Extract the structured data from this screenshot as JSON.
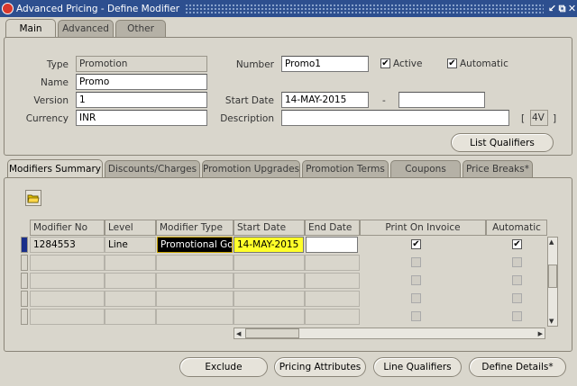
{
  "window": {
    "title": "Advanced Pricing - Define Modifier",
    "buttons": [
      "↙",
      "⧉",
      "✕"
    ]
  },
  "top_tabs": [
    {
      "label": "Main",
      "active": true
    },
    {
      "label": "Advanced",
      "active": false
    },
    {
      "label": "Other",
      "active": false
    }
  ],
  "header": {
    "type_label": "Type",
    "type_value": "Promotion",
    "name_label": "Name",
    "name_value": "Promo",
    "version_label": "Version",
    "version_value": "1",
    "currency_label": "Currency",
    "currency_value": "INR",
    "number_label": "Number",
    "number_value": "Promo1",
    "active_label": "Active",
    "active_checked": "✔",
    "automatic_label": "Automatic",
    "automatic_checked": "✔",
    "start_date_label": "Start Date",
    "start_date_value": "14-MAY-2015",
    "date_sep": "-",
    "end_date_value": "",
    "description_label": "Description",
    "description_value": "",
    "flex_open": "[",
    "flex_value": "4V",
    "flex_close": "]",
    "list_qualifiers_button": "List Qualifiers"
  },
  "sub_tabs": [
    {
      "label": "Modifiers Summary",
      "active": true
    },
    {
      "label": "Discounts/Charges",
      "active": false
    },
    {
      "label": "Promotion Upgrades",
      "active": false
    },
    {
      "label": "Promotion Terms",
      "active": false
    },
    {
      "label": "Coupons",
      "active": false
    },
    {
      "label": "Price Breaks*",
      "active": false
    }
  ],
  "grid": {
    "columns": {
      "modifier_no": "Modifier No",
      "level": "Level",
      "modifier_type": "Modifier Type",
      "start_date": "Start Date",
      "end_date": "End Date",
      "print_on_invoice": "Print On Invoice",
      "automatic": "Automatic"
    },
    "row1": {
      "modifier_no": "1284553",
      "level": "Line",
      "modifier_type": "Promotional Go",
      "start_date": "14-MAY-2015",
      "end_date": "",
      "print_on_invoice": "✔",
      "automatic": "✔"
    }
  },
  "buttons": {
    "exclude": "Exclude",
    "pricing_attributes": "Pricing Attributes",
    "line_qualifiers": "Line Qualifiers",
    "define_details": "Define Details*"
  },
  "colors": {
    "title_bar": "#2d4f8f",
    "highlight_yellow": "#ffff29",
    "current_row": "#1a2f8a",
    "window_bg": "#d9d6cc"
  }
}
